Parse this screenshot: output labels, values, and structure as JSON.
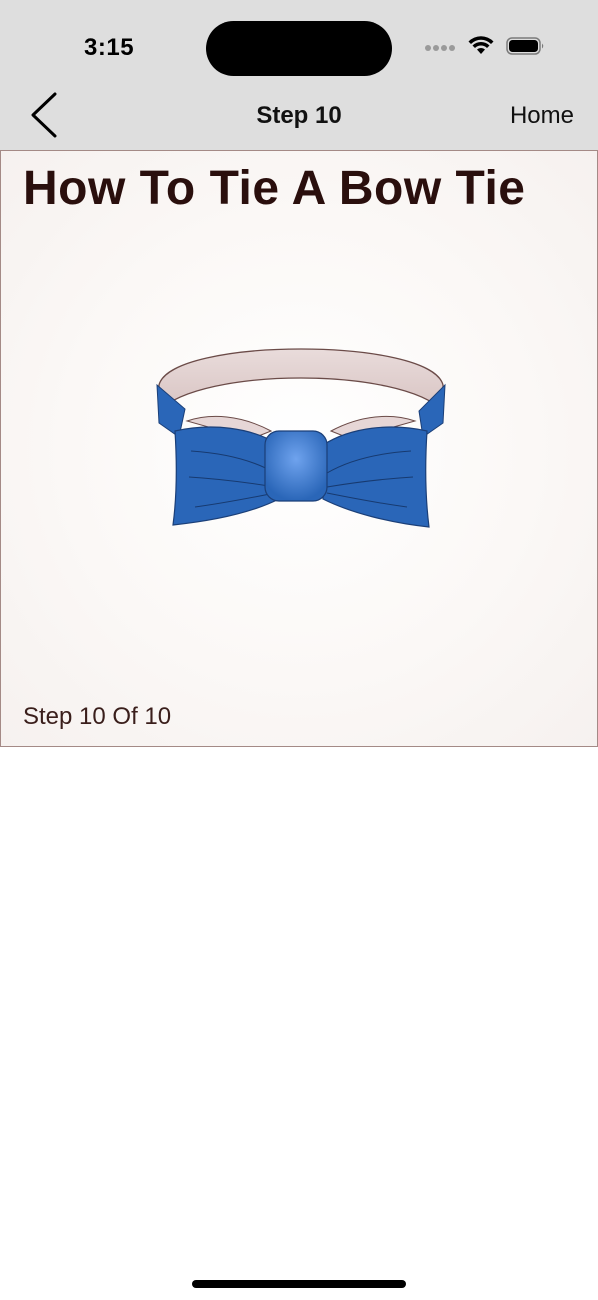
{
  "status_bar": {
    "time": "3:15",
    "icons": [
      "cellular-signal-icon",
      "wifi-icon",
      "battery-icon"
    ]
  },
  "nav": {
    "back_icon": "chevron-left-icon",
    "title": "Step 10",
    "home_label": "Home"
  },
  "content": {
    "title": "How To Tie A Bow Tie",
    "illustration": "bow-tie-illustration",
    "step_counter": "Step 10 Of 10",
    "bow_tie_color": "#2a66b8",
    "title_color": "#2a0f0d"
  },
  "colors": {
    "header_bg": "#dedede",
    "card_border": "#a48a86"
  }
}
